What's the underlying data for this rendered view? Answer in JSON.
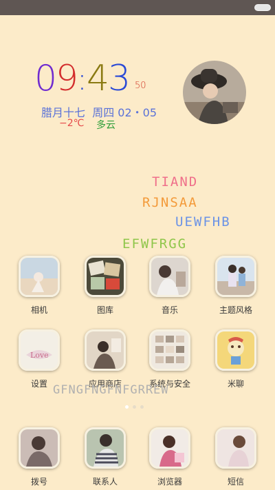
{
  "clock": {
    "h1": "0",
    "h2": "9",
    "colon": ":",
    "m1": "4",
    "m2": "3",
    "seconds": "50",
    "colors": [
      "#6f2bd0",
      "#d32d2d",
      "#2a4ad6",
      "#8a7a12",
      "#2a4ad6"
    ]
  },
  "date": {
    "lunar": "腊月十七",
    "weekday_date": "周四 02・05"
  },
  "weather": {
    "temp": "−2℃",
    "condition": "多云"
  },
  "scribbles": [
    "TIAND",
    "RJNSAA",
    "UEWFHB",
    "EFWFRGG",
    "GFNGFNGFNFGRREW"
  ],
  "apps_row1": [
    {
      "label": "相机",
      "icon": "camera-app-icon"
    },
    {
      "label": "图库",
      "icon": "gallery-app-icon"
    },
    {
      "label": "音乐",
      "icon": "music-app-icon"
    },
    {
      "label": "主题风格",
      "icon": "theme-app-icon"
    }
  ],
  "apps_row2": [
    {
      "label": "设置",
      "icon": "settings-app-icon"
    },
    {
      "label": "应用商店",
      "icon": "app-store-icon"
    },
    {
      "label": "系统与安全",
      "icon": "security-app-icon"
    },
    {
      "label": "米聊",
      "icon": "miliao-app-icon"
    }
  ],
  "dock": [
    {
      "label": "拨号",
      "icon": "phone-app-icon"
    },
    {
      "label": "联系人",
      "icon": "contacts-app-icon"
    },
    {
      "label": "浏览器",
      "icon": "browser-app-icon"
    },
    {
      "label": "短信",
      "icon": "messages-app-icon"
    }
  ],
  "pager": {
    "pages": 3,
    "current": 1
  }
}
